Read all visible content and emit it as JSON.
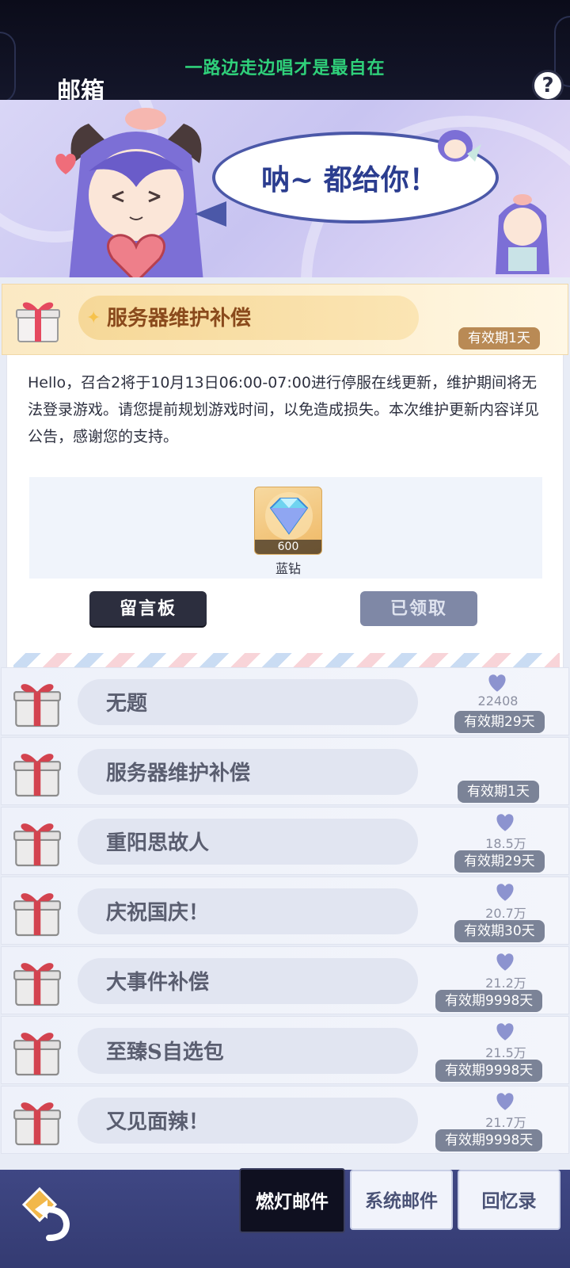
{
  "header": {
    "lyric": "一路边走边唱才是最自在",
    "title": "邮箱",
    "help_icon": "question-mark-icon",
    "help_label": "?"
  },
  "banner": {
    "speech": "呐~ 都给你！"
  },
  "open_mail": {
    "subject": "服务器维护补偿",
    "expiry": "有效期1天",
    "body": "Hello，召合2将于10月13日06:00-07:00进行停服在线更新，维护期间将无法登录游戏。请您提前规划游戏时间，以免造成损失。本次维护更新内容详见公告，感谢您的支持。",
    "attachment": {
      "icon": "diamond-icon",
      "quantity": "600",
      "name": "蓝钻"
    },
    "board_button": "留言板",
    "claim_button": "已领取"
  },
  "mails": [
    {
      "subject": "无题",
      "likes": "22408",
      "expiry": "有效期29天"
    },
    {
      "subject": "服务器维护补偿",
      "likes": "",
      "expiry": "有效期1天"
    },
    {
      "subject": "重阳思故人",
      "likes": "18.5万",
      "expiry": "有效期29天"
    },
    {
      "subject": "庆祝国庆！",
      "likes": "20.7万",
      "expiry": "有效期30天"
    },
    {
      "subject": "大事件补偿",
      "likes": "21.2万",
      "expiry": "有效期9998天"
    },
    {
      "subject": "至臻S自选包",
      "likes": "21.5万",
      "expiry": "有效期9998天"
    },
    {
      "subject": "又见面辣！",
      "likes": "21.7万",
      "expiry": "有效期9998天"
    }
  ],
  "bottom": {
    "back_icon": "back-arrow-icon",
    "tabs": [
      "燃灯邮件",
      "系统邮件",
      "回忆录"
    ]
  },
  "colors": {
    "lyric": "#2fd07a",
    "header_bg": "#0b0c1a",
    "accent_gold": "#b98a55",
    "badge_gray": "#7b8397",
    "bottom_bg": "#3f4784"
  }
}
